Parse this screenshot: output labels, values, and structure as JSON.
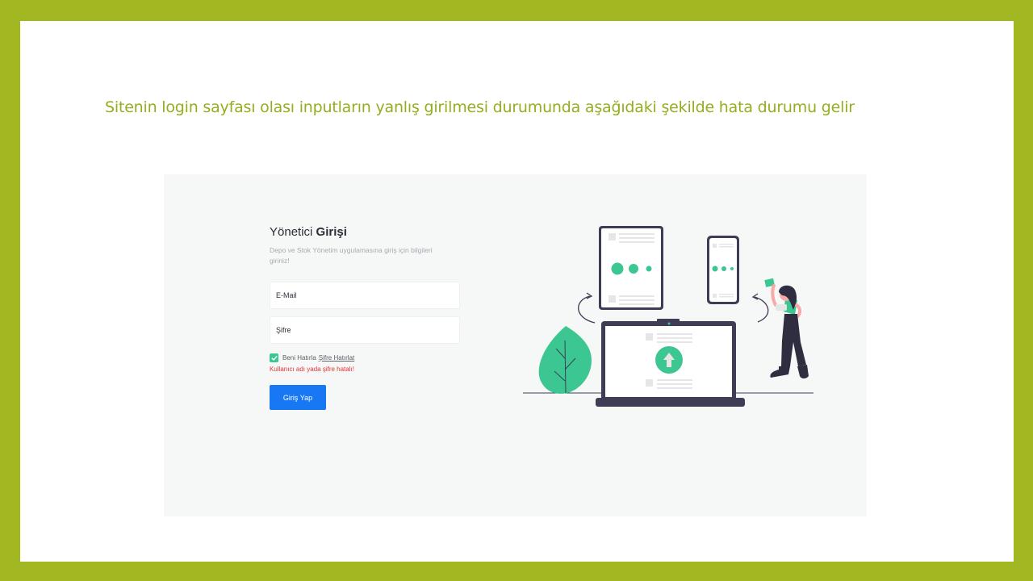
{
  "slide": {
    "title": "Sitenin login sayfası olası inputların yanlış girilmesi durumunda aşağıdaki şekilde hata durumu gelir"
  },
  "login": {
    "title_regular": "Yönetici ",
    "title_bold": "Girişi",
    "subtitle": "Depo ve Stok Yönetim uygulamasına giriş için bilgileri giriniz!",
    "email_placeholder": "E-Mail",
    "password_placeholder": "Şifre",
    "remember_label": "Beni Hatırla",
    "remember_checked": true,
    "forgot_link": "Şifre Hatırlat",
    "error_message": "Kullanıcı adı yada şifre hatalı!",
    "submit_label": "Giriş Yap"
  },
  "colors": {
    "frame": "#a3b723",
    "title": "#93ae1e",
    "accent_green": "#3cc792",
    "primary_button": "#1877f2",
    "error": "#e0343b",
    "illustration_dark": "#3f3d56"
  },
  "icons": {
    "checkbox": "check-icon",
    "upload": "arrow-up-icon"
  }
}
